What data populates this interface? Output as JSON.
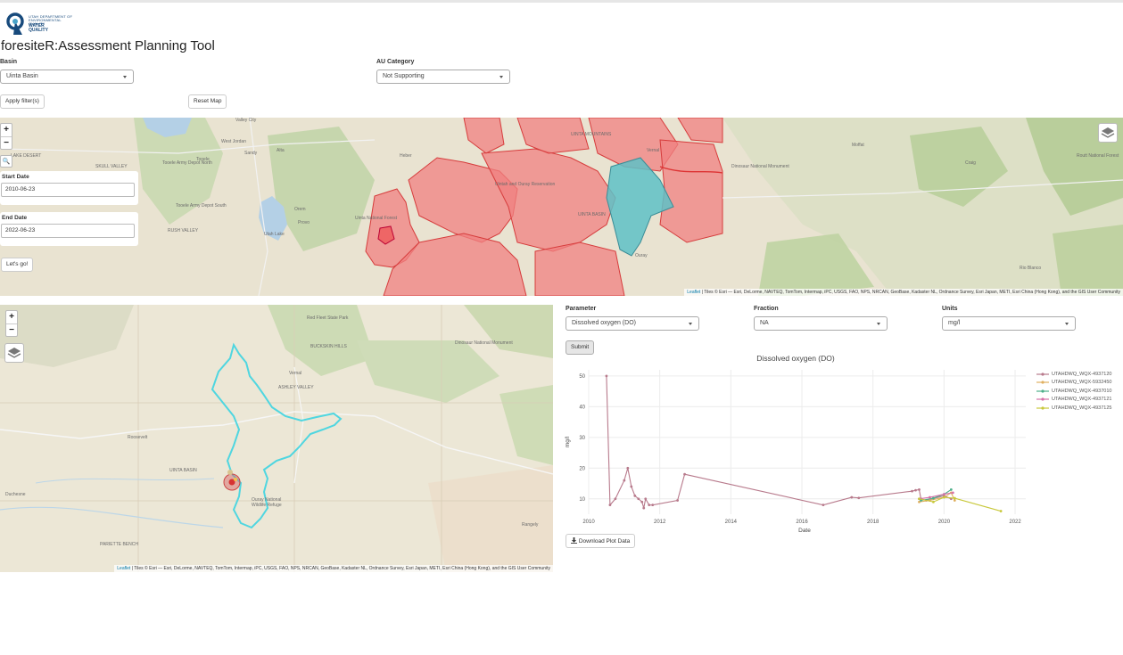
{
  "header": {
    "logo_org": "Utah Department of Environmental Quality",
    "logo_wq": "WATER QUALITY",
    "title": "foresiteR:Assessment Planning Tool"
  },
  "filters": {
    "basin_label": "Basin",
    "basin_value": "Uinta Basin",
    "au_label": "AU Category",
    "au_value": "Not Supporting",
    "apply_label": "Apply filter(s)",
    "reset_label": "Reset Map"
  },
  "map_top": {
    "date_start_label": "Start Date",
    "date_start_value": "2010-06-23",
    "date_end_label": "End Date",
    "date_end_value": "2022-06-23",
    "go_label": "Let's go!",
    "zoom_in": "+",
    "zoom_out": "−",
    "search_glyph": "🔍",
    "attribution_link": "Leaflet",
    "attribution_text": " | Tiles © Esri — Esri, DeLorme, NAVTEQ, TomTom, Intermap, iPC, USGS, FAO, NPS, NRCAN, GeoBase, Kadaster NL, Ordnance Survey, Esri Japan, METI, Esri China (Hong Kong), and the GIS User Community",
    "place_labels": [
      "Valley City",
      "West Jordan",
      "Sandy",
      "Alta",
      "Tooele Army Depot North",
      "Tooele",
      "Tooele Army Depot South",
      "Orem",
      "Provo",
      "Utah Lake",
      "RUSH VALLEY",
      "SKULL VALLEY",
      "LAKE DESERT",
      "UINTA MOUNTAINS",
      "Uintah and Ouray Reservation",
      "UINTA BASIN",
      "Vernal",
      "Ouray",
      "Heber",
      "Uinta National Forest",
      "Dinosaur National Monument",
      "Craig",
      "Moffat",
      "Rio Blanco",
      "Routt National Forest"
    ]
  },
  "map_bottom": {
    "zoom_in": "+",
    "zoom_out": "−",
    "attribution_link": "Leaflet",
    "attribution_text": " | Tiles © Esri — Esri, DeLorme, NAVTEQ, TomTom, Intermap, iPC, USGS, FAO, NPS, NRCAN, GeoBase, Kadaster NL, Ordnance Survey, Esri Japan, METI, Esri China (Hong Kong), and the GIS User Community",
    "place_labels": [
      "Red Fleet State Park",
      "BUCKSKIN HILLS",
      "Dinosaur National Monument",
      "Vernal",
      "ASHLEY VALLEY",
      "Roosevelt",
      "UINTA BASIN",
      "Duchesne",
      "Ouray National Wildlife Refuge",
      "PARIETTE BENCH",
      "Rangely"
    ]
  },
  "plot_controls": {
    "parameter_label": "Parameter",
    "parameter_value": "Dissolved oxygen (DO)",
    "fraction_label": "Fraction",
    "fraction_value": "NA",
    "units_label": "Units",
    "units_value": "mg/l",
    "submit_label": "Submit",
    "download_label": "Download Plot Data"
  },
  "chart_data": {
    "type": "line",
    "title": "Dissolved oxygen (DO)",
    "xlabel": "Date",
    "ylabel": "mg/l",
    "xlim": [
      2010,
      2022.3
    ],
    "ylim": [
      5,
      52
    ],
    "x_ticks": [
      2010,
      2012,
      2014,
      2016,
      2018,
      2020,
      2022
    ],
    "y_ticks": [
      10,
      20,
      30,
      40,
      50
    ],
    "legend_position": "right",
    "series": [
      {
        "name": "UTAHDWQ_WQX-4937120",
        "color": "#b87a8c",
        "x": [
          2010.5,
          2010.6,
          2010.75,
          2011.0,
          2011.1,
          2011.2,
          2011.3,
          2011.4,
          2011.5,
          2011.55,
          2011.6,
          2011.7,
          2011.8,
          2012.5,
          2012.7,
          2016.6,
          2017.4,
          2017.6,
          2019.1,
          2019.2,
          2019.3,
          2019.35,
          2019.5,
          2020.0,
          2020.2
        ],
        "y": [
          50,
          8,
          10,
          16,
          20,
          14,
          11,
          10,
          9,
          7,
          10,
          8,
          8,
          9.5,
          18,
          8,
          10.5,
          10.3,
          12.5,
          12.8,
          13,
          10,
          9.5,
          11,
          10
        ]
      },
      {
        "name": "UTAHDWQ_WQX-5932450",
        "color": "#e0b060",
        "x": [
          2019.3,
          2019.6,
          2020.0,
          2020.2,
          2020.3
        ],
        "y": [
          9,
          9.5,
          10.5,
          12,
          9.5
        ]
      },
      {
        "name": "UTAHDWQ_WQX-4937010",
        "color": "#4caf8a",
        "x": [
          2019.35,
          2019.7,
          2020.0,
          2020.2
        ],
        "y": [
          9.5,
          10.2,
          11.5,
          13
        ]
      },
      {
        "name": "UTAHDWQ_WQX-4937121",
        "color": "#d56fa8",
        "x": [
          2019.3,
          2019.6,
          2020.0,
          2020.25
        ],
        "y": [
          10,
          10.5,
          11.5,
          12
        ]
      },
      {
        "name": "UTAHDWQ_WQX-4937125",
        "color": "#c8c83a",
        "x": [
          2019.3,
          2019.7,
          2020.0,
          2020.3,
          2021.6
        ],
        "y": [
          10,
          9,
          10.5,
          10.2,
          6
        ]
      }
    ]
  }
}
